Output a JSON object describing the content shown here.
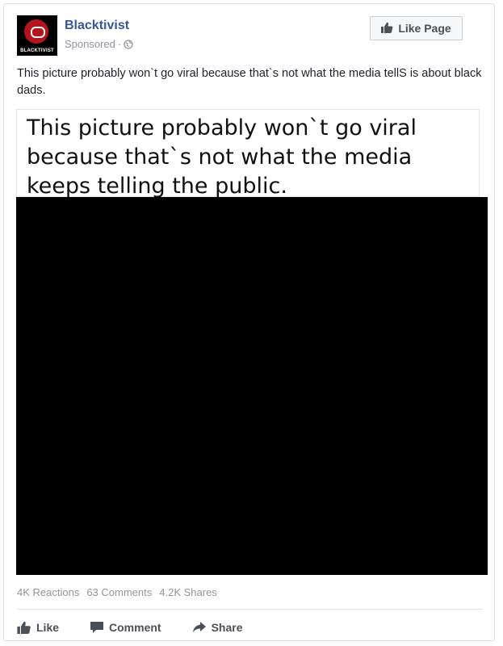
{
  "post": {
    "page_name": "Blacktivist",
    "avatar_text": "BLACKTIVIST",
    "sponsored": "Sponsored",
    "dot": "·",
    "like_page_label": "Like Page",
    "text": "This picture probably won`t go viral because that`s not what the media tellS is about black dads.",
    "image_caption": "This picture probably won`t go viral because that`s not what the media keeps telling the public."
  },
  "stats": {
    "reactions": "4K Reactions",
    "comments": "63 Comments",
    "shares": "4.2K Shares"
  },
  "actions": {
    "like": "Like",
    "comment": "Comment",
    "share": "Share"
  },
  "icons": {
    "globe": "globe-icon",
    "thumbs_up": "thumbs-up-icon",
    "comment": "speech-bubble-icon",
    "share": "share-arrow-icon"
  },
  "colors": {
    "link": "#365899",
    "muted": "#90949c",
    "border": "#dddfe2",
    "brand_red": "#b3141d"
  }
}
